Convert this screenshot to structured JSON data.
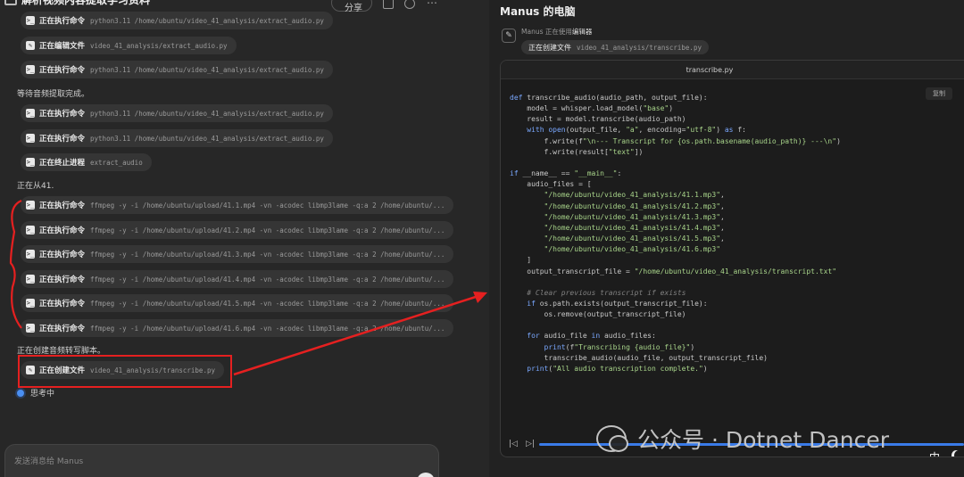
{
  "header": {
    "task_title": "解析视频内容提取学习资料",
    "share_label": "分享"
  },
  "steps": [
    {
      "label": "正在执行命令",
      "arg": "python3.11 /home/ubuntu/video_41_analysis/extract_audio.py",
      "icon": "terminal-icon"
    },
    {
      "label": "正在编辑文件",
      "arg": "video_41_analysis/extract_audio.py",
      "icon": "edit-icon"
    },
    {
      "label": "正在执行命令",
      "arg": "python3.11 /home/ubuntu/video_41_analysis/extract_audio.py",
      "icon": "terminal-icon"
    },
    {
      "label": "正在执行命令",
      "arg": "python3.11 /home/ubuntu/video_41_analysis/extract_audio.py",
      "icon": "terminal-icon"
    },
    {
      "label": "正在执行命令",
      "arg": "python3.11 /home/ubuntu/video_41_analysis/extract_audio.py",
      "icon": "terminal-icon"
    },
    {
      "label": "正在终止进程",
      "arg": "extract_audio",
      "icon": "terminal-icon"
    },
    {
      "label": "正在执行命令",
      "arg": "ffmpeg -y -i /home/ubuntu/upload/41.1.mp4 -vn -acodec libmp3lame -q:a 2 /home/ubuntu/...",
      "icon": "terminal-icon"
    },
    {
      "label": "正在执行命令",
      "arg": "ffmpeg -y -i /home/ubuntu/upload/41.2.mp4 -vn -acodec libmp3lame -q:a 2 /home/ubuntu/...",
      "icon": "terminal-icon"
    },
    {
      "label": "正在执行命令",
      "arg": "ffmpeg -y -i /home/ubuntu/upload/41.3.mp4 -vn -acodec libmp3lame -q:a 2 /home/ubuntu/...",
      "icon": "terminal-icon"
    },
    {
      "label": "正在执行命令",
      "arg": "ffmpeg -y -i /home/ubuntu/upload/41.4.mp4 -vn -acodec libmp3lame -q:a 2 /home/ubuntu/...",
      "icon": "terminal-icon"
    },
    {
      "label": "正在执行命令",
      "arg": "ffmpeg -y -i /home/ubuntu/upload/41.5.mp4 -vn -acodec libmp3lame -q:a 2 /home/ubuntu/...",
      "icon": "terminal-icon"
    },
    {
      "label": "正在执行命令",
      "arg": "ffmpeg -y -i /home/ubuntu/upload/41.6.mp4 -vn -acodec libmp3lame -q:a 2 /home/ubuntu/...",
      "icon": "terminal-icon"
    },
    {
      "label": "正在创建文件",
      "arg": "video_41_analysis/transcribe.py",
      "icon": "edit-icon"
    }
  ],
  "messages": {
    "wait_audio": "等待音频提取完成。",
    "from_41": "正在从41.",
    "creating_script": "正在创建音频转写脚本。"
  },
  "status": {
    "thinking": "思考中"
  },
  "composer": {
    "placeholder": "发送消息给 Manus"
  },
  "computer": {
    "title": "Manus 的电脑",
    "using_prefix": "Manus 正在使用",
    "using_tool": "编辑器",
    "action_label": "正在创建文件",
    "action_arg": "video_41_analysis/transcribe.py",
    "filename": "transcribe.py",
    "copy_label": "复制",
    "code": "def transcribe_audio(audio_path, output_file):\n    model = whisper.load_model(\"base\")\n    result = model.transcribe(audio_path)\n    with open(output_file, \"a\", encoding=\"utf-8\") as f:\n        f.write(f\"\\n--- Transcript for {os.path.basename(audio_path)} ---\\n\")\n        f.write(result[\"text\"])\n\nif __name__ == \"__main__\":\n    audio_files = [\n        \"/home/ubuntu/video_41_analysis/41.1.mp3\",\n        \"/home/ubuntu/video_41_analysis/41.2.mp3\",\n        \"/home/ubuntu/video_41_analysis/41.3.mp3\",\n        \"/home/ubuntu/video_41_analysis/41.4.mp3\",\n        \"/home/ubuntu/video_41_analysis/41.5.mp3\",\n        \"/home/ubuntu/video_41_analysis/41.6.mp3\"\n    ]\n    output_transcript_file = \"/home/ubuntu/video_41_analysis/transcript.txt\"\n\n    # Clear previous transcript if exists\n    if os.path.exists(output_transcript_file):\n        os.remove(output_transcript_file)\n\n    for audio_file in audio_files:\n        print(f\"Transcribing {audio_file}\")\n        transcribe_audio(audio_file, output_transcript_file)\n    print(\"All audio transcription complete.\")",
    "lang_badge": "中",
    "progress": 1.0
  },
  "watermark": {
    "text": "公众号 · Dotnet Dancer"
  },
  "colors": {
    "accent": "#3a7be8",
    "annotation": "#e52020"
  }
}
